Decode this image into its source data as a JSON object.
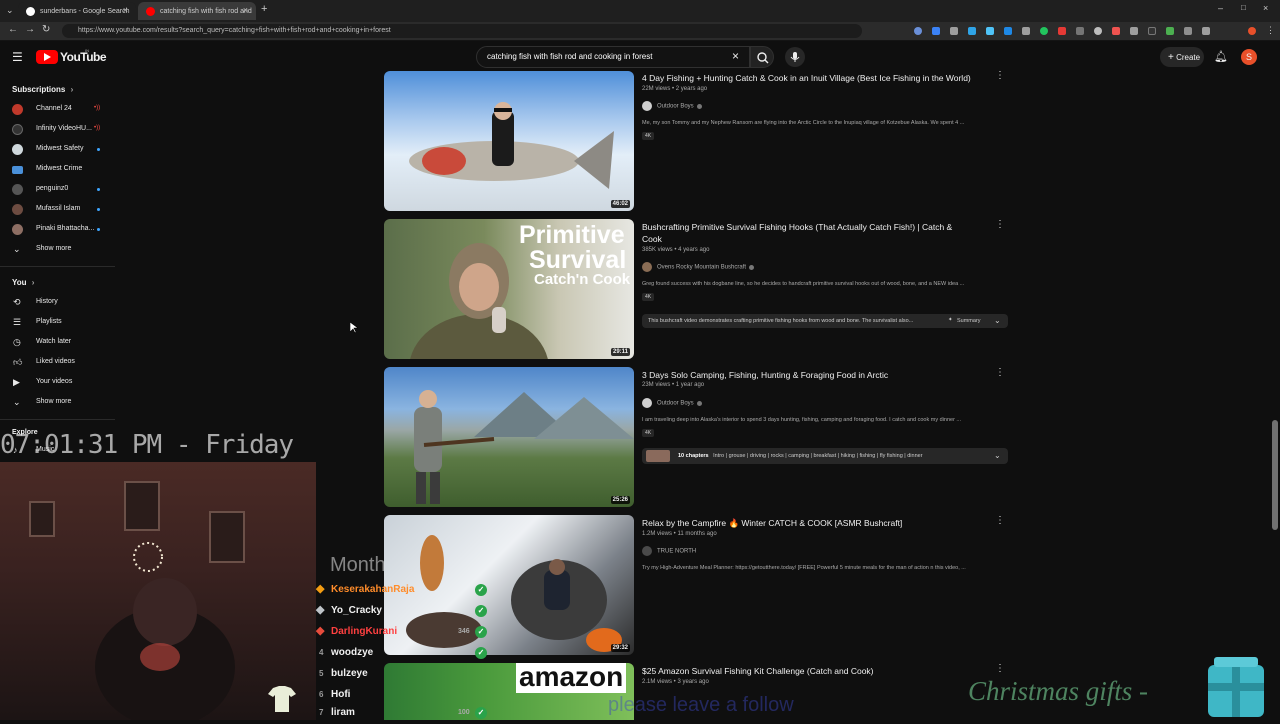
{
  "browser": {
    "tabs": [
      {
        "title": "sunderbans - Google Search",
        "active": false
      },
      {
        "title": "catching fish with fish rod and",
        "active": true
      }
    ],
    "new_tab_glyph": "+",
    "url": "https://www.youtube.com/results?search_query=catching+fish+with+fish+rod+and+cooking+in+forest"
  },
  "header": {
    "logo_text": "YouTube",
    "logo_superscript": "IN",
    "search_value": "catching fish with fish rod and cooking in forest",
    "create_label": "Create",
    "avatar_letter": "S"
  },
  "sidebar": {
    "subscriptions_heading": "Subscriptions",
    "subscriptions": [
      {
        "name": "Channel 24",
        "indicator": "live",
        "color": "#c0392b"
      },
      {
        "name": "Infinity VideoHU...",
        "indicator": "live",
        "color": "#333333"
      },
      {
        "name": "Midwest Safety",
        "indicator": "dot",
        "color": "#cfd8dc"
      },
      {
        "name": "Midwest Crime",
        "indicator": "none",
        "color": "#4a90d9"
      },
      {
        "name": "penguinz0",
        "indicator": "dot",
        "color": "#555555"
      },
      {
        "name": "Mufassil Islam",
        "indicator": "dot",
        "color": "#6d4c41"
      },
      {
        "name": "Pinaki Bhattacha...",
        "indicator": "dot",
        "color": "#8d6e63"
      }
    ],
    "show_more_1": "Show more",
    "you_heading": "You",
    "you_items": [
      "History",
      "Playlists",
      "Watch later",
      "Liked videos",
      "Your videos"
    ],
    "show_more_2": "Show more",
    "explore_heading": "Explore",
    "explore_items": [
      "Music"
    ]
  },
  "results": [
    {
      "title": "4 Day Fishing + Hunting Catch & Cook in an Inuit Village (Best Ice Fishing in the World)",
      "meta": "22M views • 2 years ago",
      "channel": "Outdoor Boys",
      "description": "Me, my son Tommy and my Nephew Ransom are flying into the Arctic Circle to the Inupiaq village of Kotzebue Alaska. We spent 4 ...",
      "badge": "4K",
      "duration": "46:02"
    },
    {
      "title": "Bushcrafting Primitive Survival Fishing Hooks (That Actually Catch Fish!) | Catch & Cook",
      "meta": "385K views • 4 years ago",
      "channel": "Ovens Rocky Mountain Bushcraft",
      "description": "Greg found success with his dogbane line, so he decides to handcraft primitive survival hooks out of wood, bone, and a NEW idea ...",
      "badge": "4K",
      "summary_text": "This bushcraft video demonstrates crafting primitive fishing hooks from wood and bone. The survivalist also...",
      "summary_label": "Summary",
      "duration": "29:11",
      "thumb_text_1": "Primitive",
      "thumb_text_2": "Survival",
      "thumb_text_3": "Catch'n Cook"
    },
    {
      "title": "3 Days Solo Camping, Fishing, Hunting & Foraging Food in Arctic",
      "meta": "23M views • 1 year ago",
      "channel": "Outdoor Boys",
      "description": "I am traveling deep into Alaska's interior to spend 3 days hunting, fishing, camping and foraging food. I catch and cook my dinner ...",
      "badge": "4K",
      "chapters_label": "10 chapters",
      "chapters_text": "Intro | grouse | driving | rocks | camping | breakfast | hiking | fishing | fly fishing | dinner",
      "duration": "25:26"
    },
    {
      "title": "Relax by the Campfire 🔥 Winter CATCH & COOK [ASMR Bushcraft]",
      "meta": "1.2M views • 11 months ago",
      "channel": "TRUE NORTH",
      "description": "Try my High-Adventure Meal Planner: https://getoutthere.today/ [FREE] Powerful 5 minute meals for the man of action n this video, ...",
      "duration": "29:32"
    },
    {
      "title": "$25 Amazon Survival Fishing Kit Challenge (Catch and Cook)",
      "meta": "2.1M views • 3 years ago",
      "thumb_text": "amazon"
    }
  ],
  "overlay": {
    "clock": "07:01:31 PM - Friday",
    "leaderboard_title": "Month",
    "leaderboard": [
      {
        "rank": "",
        "name": "KeserakahanRaja",
        "color": "#ff8c2a",
        "count": ""
      },
      {
        "rank": "",
        "name": "Yo_Cracky",
        "color": "#e0e0e0",
        "count": ""
      },
      {
        "rank": "",
        "name": "DarlingKurani",
        "color": "#ff4040",
        "count": "346"
      },
      {
        "rank": "4",
        "name": "woodzye",
        "color": "#e0e0e0",
        "count": ""
      },
      {
        "rank": "5",
        "name": "bulzeye",
        "color": "#e0e0e0",
        "count": ""
      },
      {
        "rank": "6",
        "name": "Hofi",
        "color": "#e0e0e0",
        "count": ""
      },
      {
        "rank": "7",
        "name": "liram",
        "color": "#e0e0e0",
        "count": "100"
      }
    ],
    "christmas_text": "Christmas gifts -",
    "follow_text": "please leave a follow"
  }
}
